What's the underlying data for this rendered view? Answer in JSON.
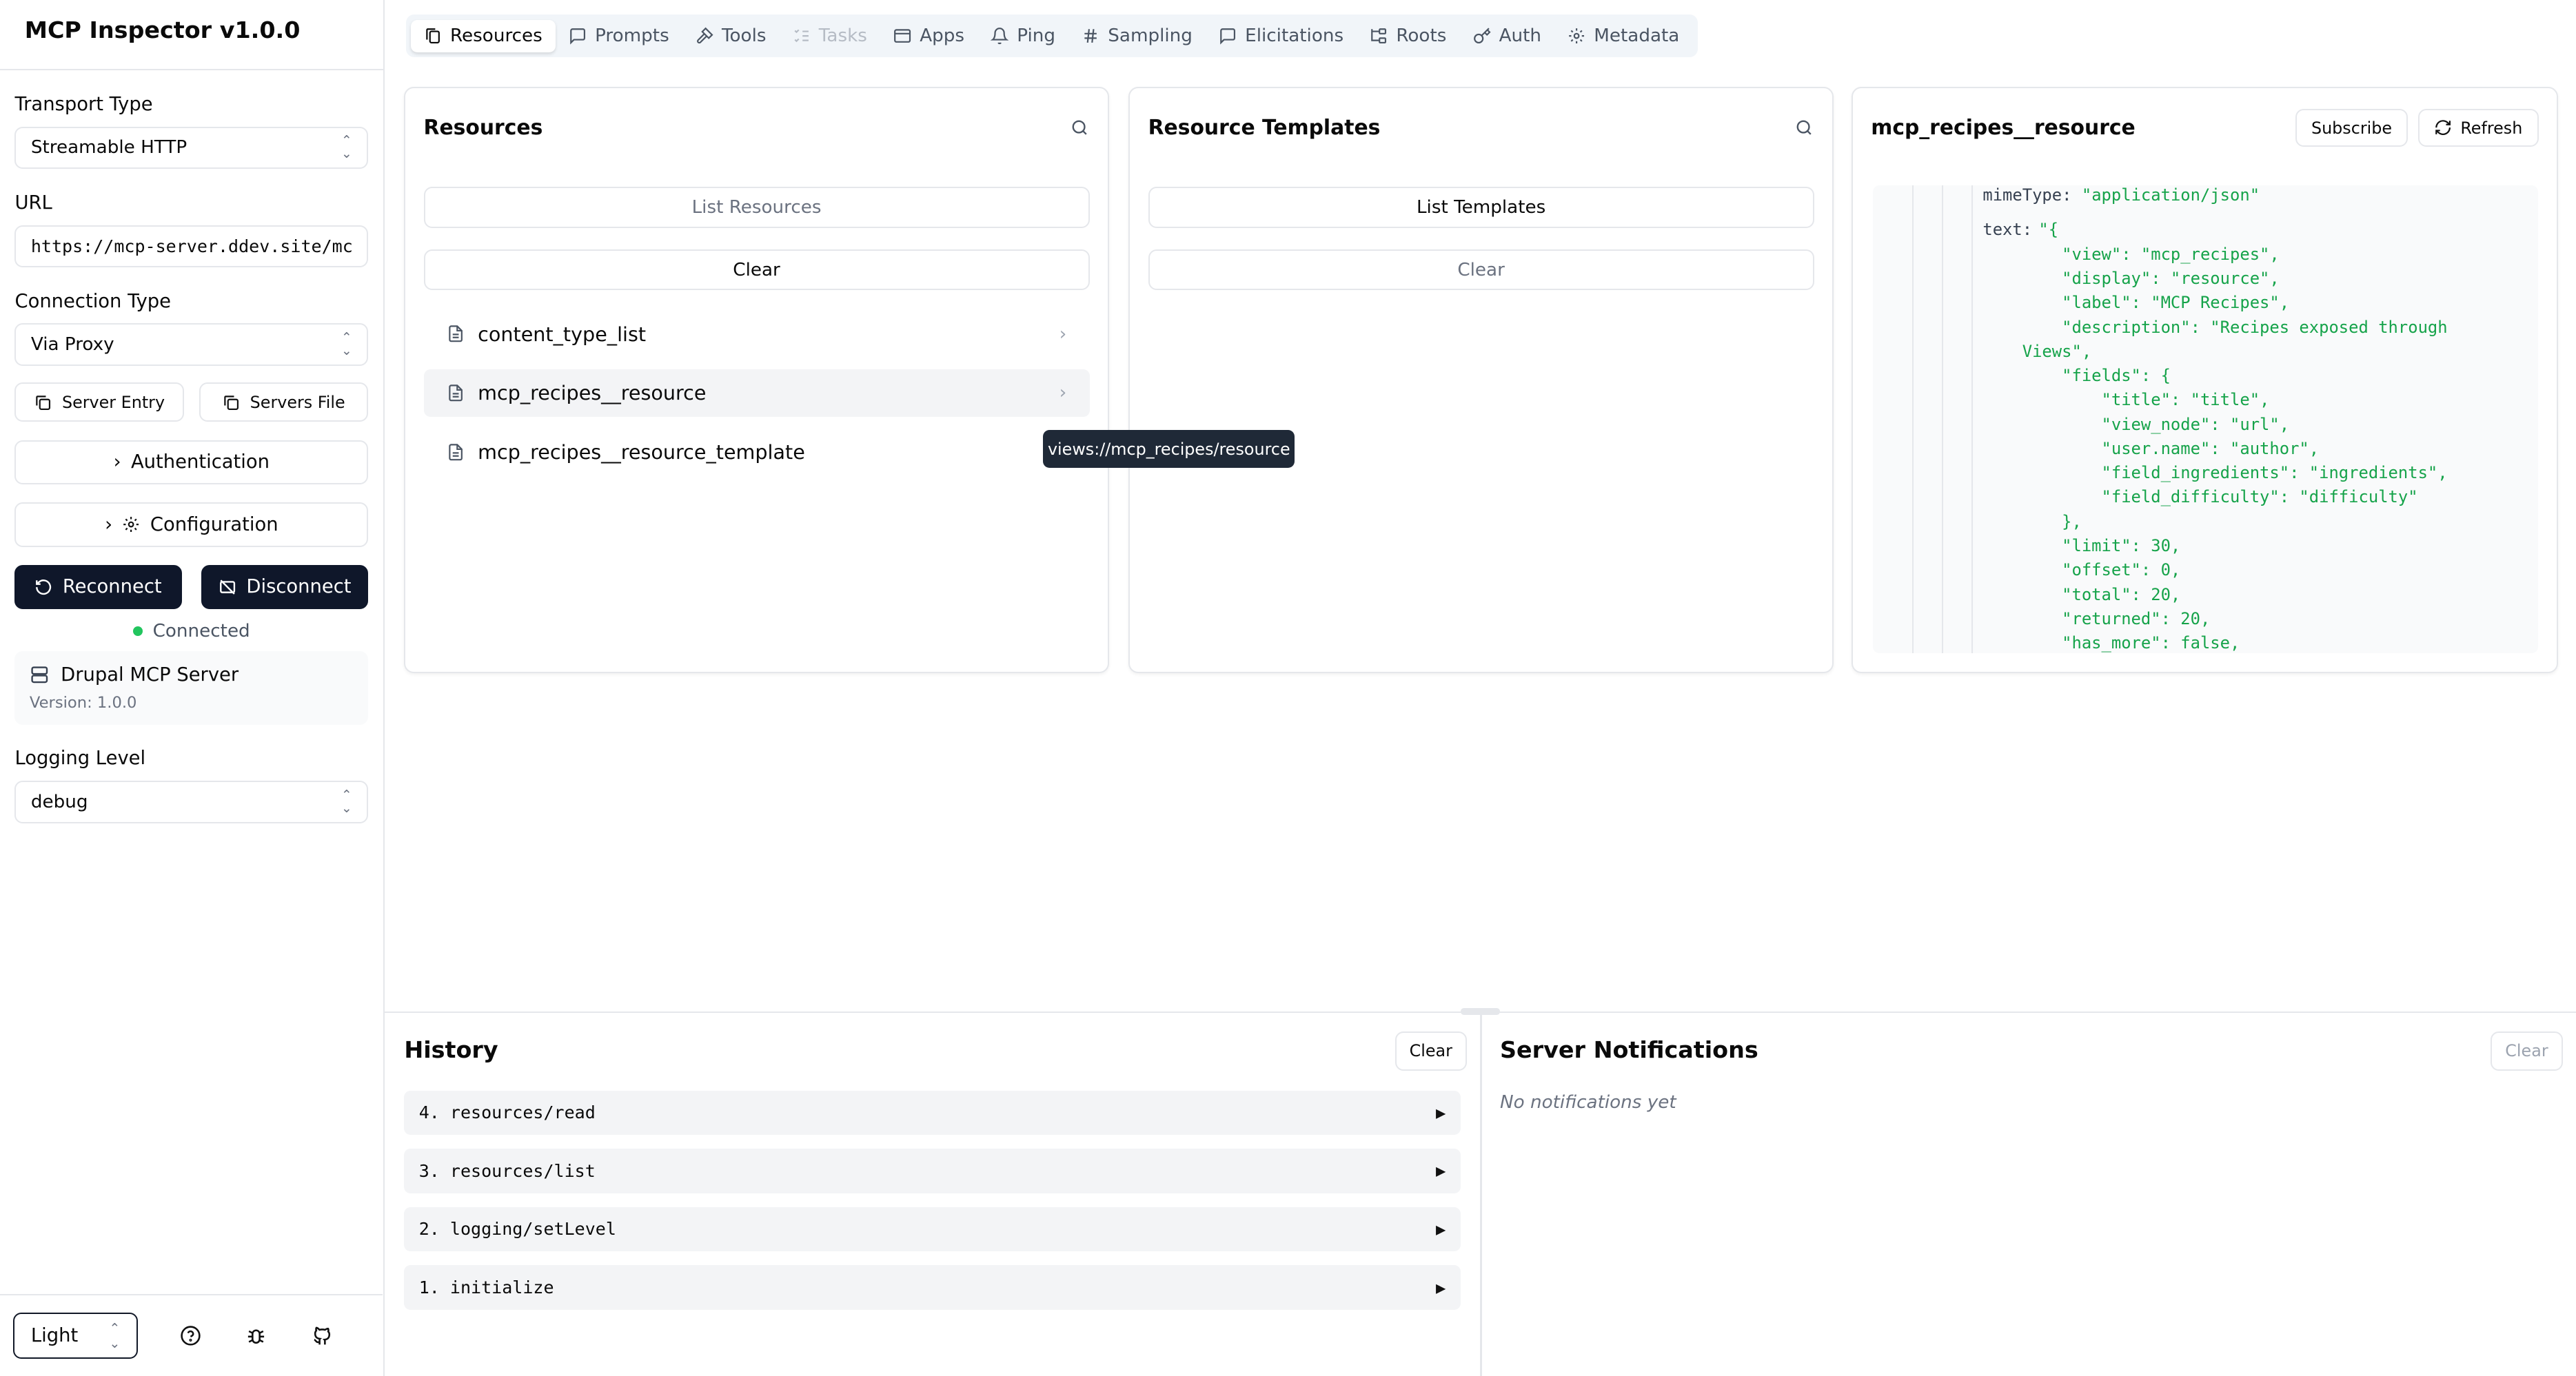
{
  "app": {
    "title": "MCP Inspector v1.0.0"
  },
  "sidebar": {
    "transport_label": "Transport Type",
    "transport_value": "Streamable HTTP",
    "url_label": "URL",
    "url_value": "https://mcp-server.ddev.site/mc",
    "connection_label": "Connection Type",
    "connection_value": "Via Proxy",
    "server_entry": "Server Entry",
    "servers_file": "Servers File",
    "authentication": "Authentication",
    "configuration": "Configuration",
    "reconnect": "Reconnect",
    "disconnect": "Disconnect",
    "status": "Connected",
    "status_color": "#22c55e",
    "server_name": "Drupal MCP Server",
    "server_version": "Version: 1.0.0",
    "logging_label": "Logging Level",
    "logging_value": "debug",
    "theme_value": "Light"
  },
  "tabs": [
    {
      "label": "Resources",
      "icon": "files-icon",
      "state": "active"
    },
    {
      "label": "Prompts",
      "icon": "message-icon",
      "state": "normal"
    },
    {
      "label": "Tools",
      "icon": "hammer-icon",
      "state": "normal"
    },
    {
      "label": "Tasks",
      "icon": "list-todo-icon",
      "state": "disabled"
    },
    {
      "label": "Apps",
      "icon": "app-window-icon",
      "state": "normal"
    },
    {
      "label": "Ping",
      "icon": "bell-icon",
      "state": "normal"
    },
    {
      "label": "Sampling",
      "icon": "hash-icon",
      "state": "normal"
    },
    {
      "label": "Elicitations",
      "icon": "message-icon",
      "state": "normal"
    },
    {
      "label": "Roots",
      "icon": "folder-tree-icon",
      "state": "normal"
    },
    {
      "label": "Auth",
      "icon": "key-icon",
      "state": "normal"
    },
    {
      "label": "Metadata",
      "icon": "gear-icon",
      "state": "normal"
    }
  ],
  "resources": {
    "title": "Resources",
    "list_button": "List Resources",
    "clear_button": "Clear",
    "items": [
      "content_type_list",
      "mcp_recipes__resource",
      "mcp_recipes__resource_template"
    ],
    "tooltip": "views://mcp_recipes/resource"
  },
  "templates": {
    "title": "Resource Templates",
    "list_button": "List Templates",
    "clear_button": "Clear"
  },
  "detail": {
    "title": "mcp_recipes__resource",
    "subscribe": "Subscribe",
    "refresh": "Refresh",
    "mime_key": "mimeType:",
    "mime_value": "\"application/json\"",
    "text_key": "text:",
    "text_lines": [
      "\"{",
      "        \"view\": \"mcp_recipes\",",
      "        \"display\": \"resource\",",
      "        \"label\": \"MCP Recipes\",",
      "        \"description\": \"Recipes exposed through",
      "    Views\",",
      "        \"fields\": {",
      "            \"title\": \"title\",",
      "            \"view_node\": \"url\",",
      "            \"user.name\": \"author\",",
      "            \"field_ingredients\": \"ingredients\",",
      "            \"field_difficulty\": \"difficulty\"",
      "        },",
      "        \"limit\": 30,",
      "        \"offset\": 0,",
      "        \"total\": 20,",
      "        \"returned\": 20,",
      "        \"has_more\": false,"
    ]
  },
  "history": {
    "title": "History",
    "clear": "Clear",
    "items": [
      "4. resources/read",
      "3. resources/list",
      "2. logging/setLevel",
      "1. initialize"
    ]
  },
  "notifications": {
    "title": "Server Notifications",
    "clear": "Clear",
    "empty": "No notifications yet"
  }
}
